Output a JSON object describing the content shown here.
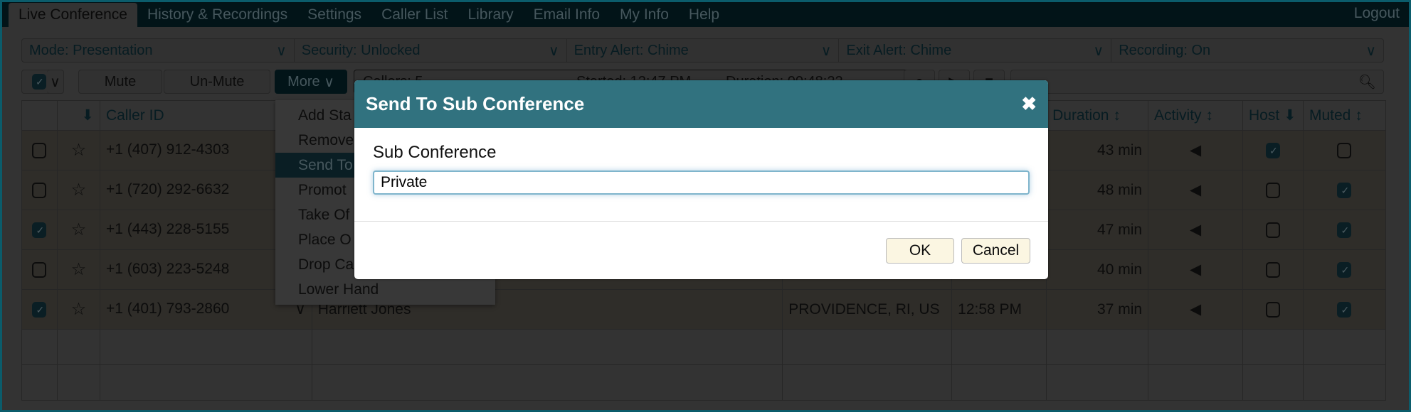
{
  "tabs": [
    "Live Conference",
    "History & Recordings",
    "Settings",
    "Caller List",
    "Library",
    "Email Info",
    "My Info",
    "Help"
  ],
  "logout": "Logout",
  "dropdowns": [
    "Mode: Presentation",
    "Security: Unlocked",
    "Entry Alert: Chime",
    "Exit Alert: Chime",
    "Recording: On"
  ],
  "toolbar": {
    "mute": "Mute",
    "unmute": "Un-Mute",
    "more": "More",
    "callers": "Callers: 5",
    "started": "Started: 12:47 PM",
    "duration": "Duration: 00:48:22"
  },
  "table": {
    "headers": {
      "caller_id": "Caller ID",
      "duration": "Duration",
      "activity": "Activity",
      "host": "Host",
      "muted": "Muted"
    },
    "rows": [
      {
        "checked": false,
        "caller_id": "+1 (407) 912-4303",
        "name": "",
        "location": "",
        "time": "",
        "duration": "43 min",
        "host": true,
        "muted": false
      },
      {
        "checked": false,
        "caller_id": "+1 (720) 292-6632",
        "name": "",
        "location": "",
        "time": "",
        "duration": "48 min",
        "host": false,
        "muted": true
      },
      {
        "checked": true,
        "caller_id": "+1 (443) 228-5155",
        "name": "",
        "location": "",
        "time": "",
        "duration": "47 min",
        "host": false,
        "muted": true
      },
      {
        "checked": false,
        "caller_id": "+1 (603) 223-5248",
        "name": "",
        "location": "",
        "time": "",
        "duration": "40 min",
        "host": false,
        "muted": true
      },
      {
        "checked": true,
        "caller_id": "+1 (401) 793-2860",
        "name": "Harriett Jones",
        "location": "PROVIDENCE, RI, US",
        "time": "12:58 PM",
        "duration": "37 min",
        "host": false,
        "muted": true
      }
    ]
  },
  "menu": [
    "Add Sta",
    "Remove",
    "Send To",
    "Promot",
    "Take Of",
    "Place O",
    "Drop Ca",
    "Lower Hand"
  ],
  "dialog": {
    "title": "Send To Sub Conference",
    "label": "Sub Conference",
    "value": "Private",
    "ok": "OK",
    "cancel": "Cancel"
  },
  "colors": {
    "brand": "#0b6478",
    "dialog_header": "#31727f"
  }
}
